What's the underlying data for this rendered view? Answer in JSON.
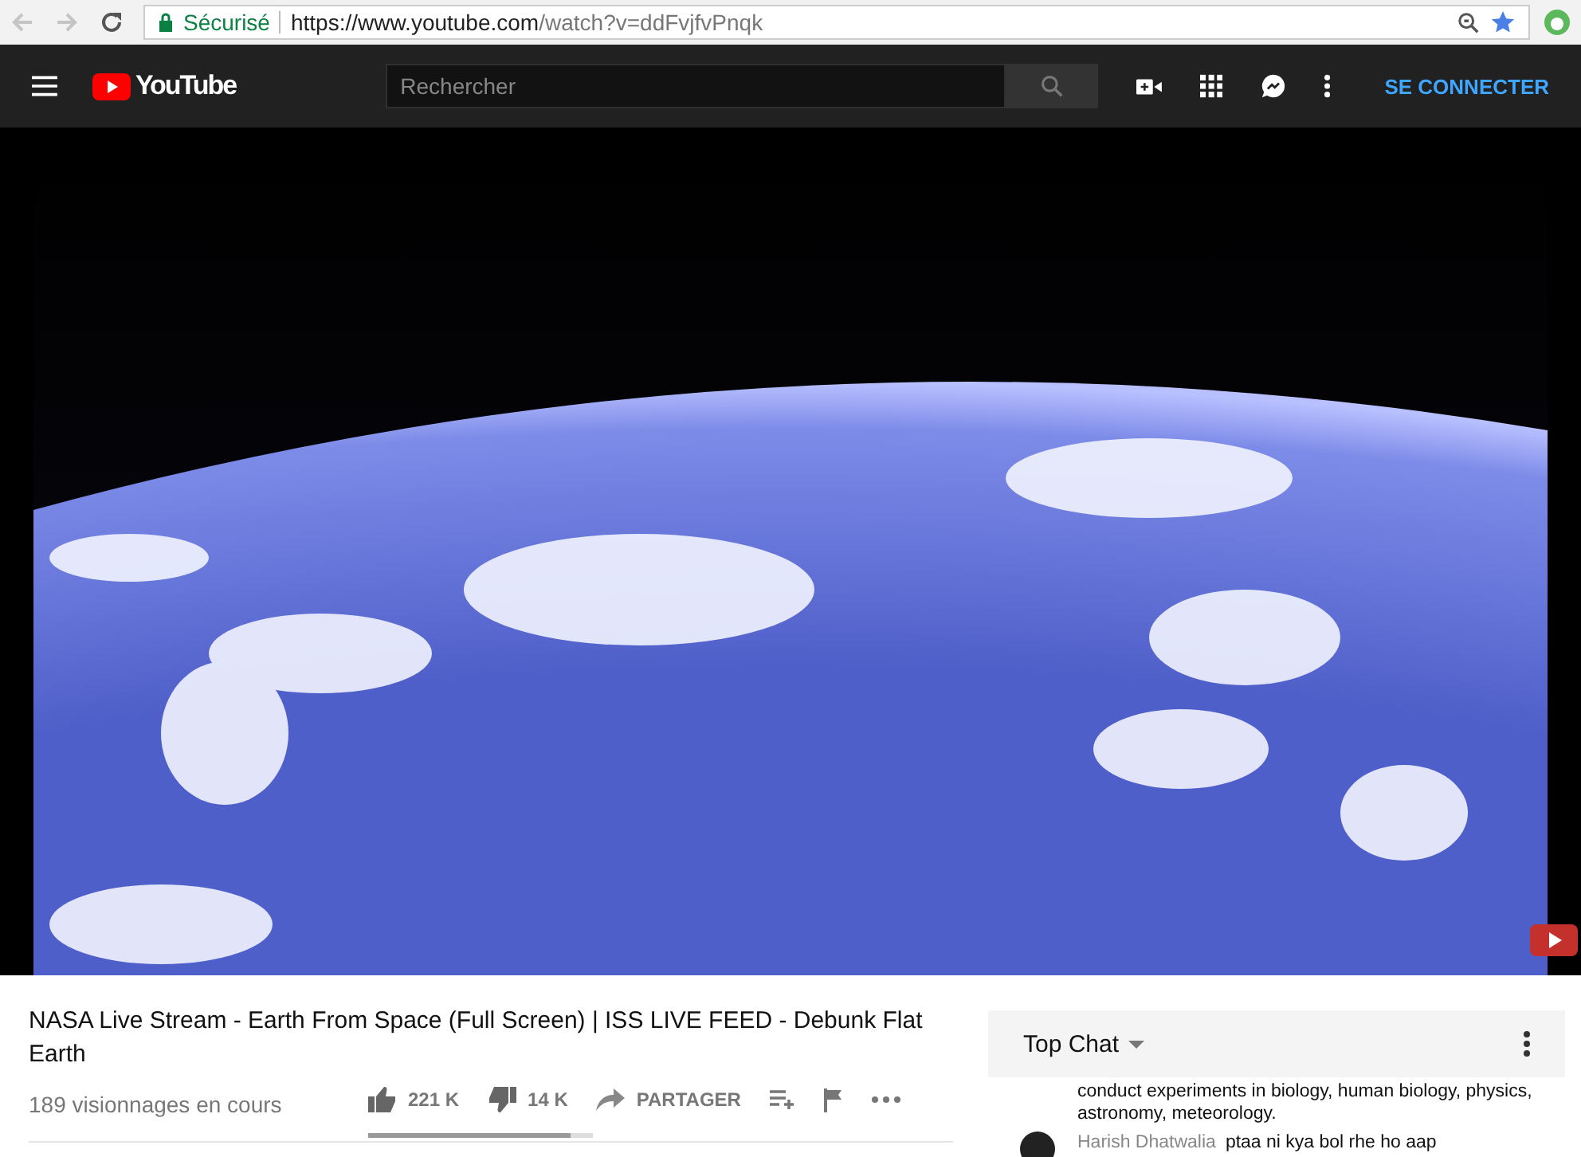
{
  "browser": {
    "secure_label": "Sécurisé",
    "url_host": "https://www.youtube.com",
    "url_path": "/watch?v=ddFvjfvPnqk"
  },
  "header": {
    "logo_text": "YouTube",
    "search": {
      "placeholder": "Rechercher"
    },
    "sign_in": "SE CONNECTER"
  },
  "video": {
    "title": "NASA Live Stream - Earth From Space (Full Screen) | ISS LIVE FEED - Debunk Flat Earth",
    "views": "189 visionnages en cours",
    "likes": "221 K",
    "dislikes": "14 K",
    "share": "PARTAGER",
    "sentiment": {
      "level": 0.9
    }
  },
  "chat": {
    "title": "Top Chat",
    "messages": [
      {
        "text": "conduct experiments in biology, human biology, physics, astronomy, meteorology."
      },
      {
        "author": "Harish Dhatwalia",
        "text": "ptaa ni kya bol rhe ho aap"
      }
    ]
  }
}
